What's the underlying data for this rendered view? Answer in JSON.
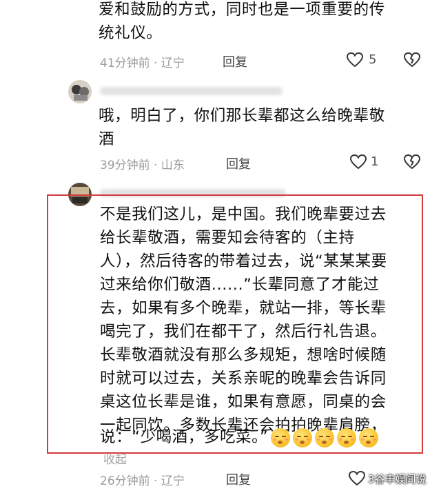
{
  "comments": [
    {
      "text": "爱和鼓励的方式，同时也是一项重要的传\n统礼仪。",
      "meta": "41分钟前 · 辽宁",
      "reply_label": "回复",
      "like_count": "5"
    },
    {
      "text": "哦，明白了，你们那长辈都这么给晚辈敬\n酒",
      "meta": "39分钟前 · 山东",
      "reply_label": "回复",
      "like_count": "1"
    },
    {
      "text": "不是我们这儿，是中国。我们晚辈要过去\n给长辈敬酒，需要知会待客的（主持\n人），然后待客的带着过去，说“某某某要\n过来给你们敬酒......”长辈同意了才能过\n去，如果有多个晚辈，就站一排，等长辈\n喝完了，我们在都干了，然后行礼告退。\n长辈敬酒就没有那么多规矩，想啥时候随\n时就可以过去，关系亲昵的晚辈会告诉同\n桌这位长辈是谁，如果有意愿，同桌的会\n一起同饮。多数长辈还会拍拍晚辈肩膀，",
      "last_line": "说：“少喝酒，多吃菜。”",
      "collapse_label": "收起",
      "meta": "26分钟前 · 辽宁",
      "reply_label": "回复"
    }
  ],
  "watermark": "3谷丰娱闻说",
  "icons": {
    "like": "heart-outline-icon",
    "dislike": "broken-heart-icon",
    "emoji": "shy-face-emoji"
  },
  "colors": {
    "highlight_border": "#d23a3a"
  }
}
